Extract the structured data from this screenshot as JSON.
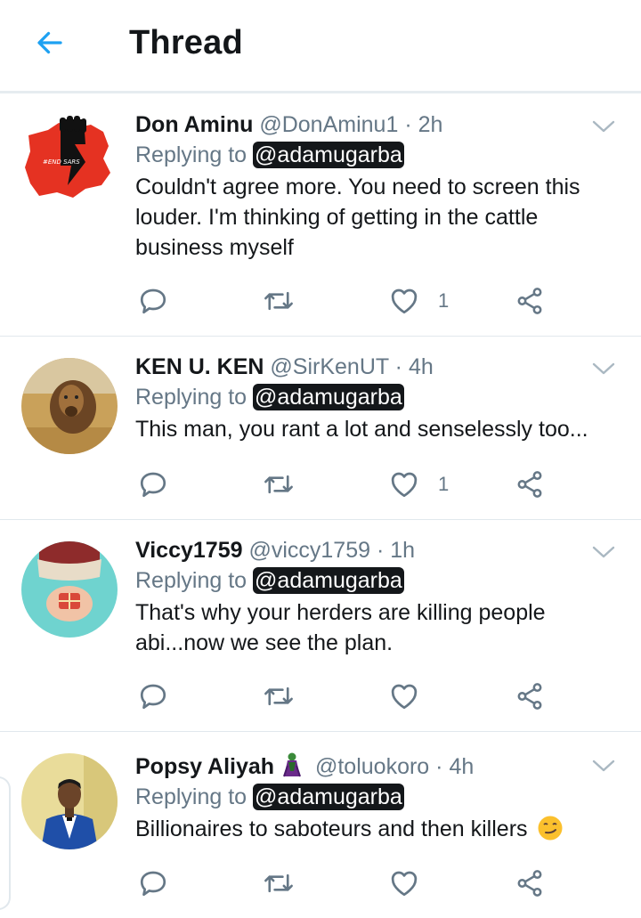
{
  "header": {
    "title": "Thread",
    "back_icon": "arrow-left-icon",
    "accent": "#1da1f2"
  },
  "tweets": [
    {
      "name": "Don Aminu",
      "handle": "@DonAminu1",
      "time": "· 2h",
      "replying_prefix": "Replying to",
      "replying_to": "@adamugarba",
      "text": "Couldn't agree more. You need to screen this louder. I'm thinking of getting in the cattle business myself",
      "like_count": "1",
      "avatar_text": "#END SARS"
    },
    {
      "name": "KEN U. KEN",
      "handle": "@SirKenUT",
      "time": "· 4h",
      "replying_prefix": "Replying to",
      "replying_to": "@adamugarba",
      "text": "This man, you rant a lot and senselessly too...",
      "like_count": "1"
    },
    {
      "name": "Viccy1759",
      "handle": "@viccy1759",
      "time": "· 1h",
      "replying_prefix": "Replying to",
      "replying_to": "@adamugarba",
      "text": "That's why your herders are killing people abi...now we see the plan.",
      "like_count": ""
    },
    {
      "name": "Popsy Aliyah",
      "name_emoji": "villain-emoji",
      "handle": "@toluokoro",
      "time": "· 4h",
      "replying_prefix": "Replying to",
      "replying_to": "@adamugarba",
      "text": "Billionaires to saboteurs and then killers",
      "text_emoji": "smirking-face-emoji",
      "like_count": ""
    }
  ],
  "icons": {
    "reply": "reply-bubble-icon",
    "retweet": "retweet-icon",
    "like": "heart-icon",
    "share": "share-icon",
    "menu": "chevron-down-icon"
  },
  "colors": {
    "text": "#14171a",
    "secondary": "#657786",
    "divider": "#e1e8ed"
  }
}
